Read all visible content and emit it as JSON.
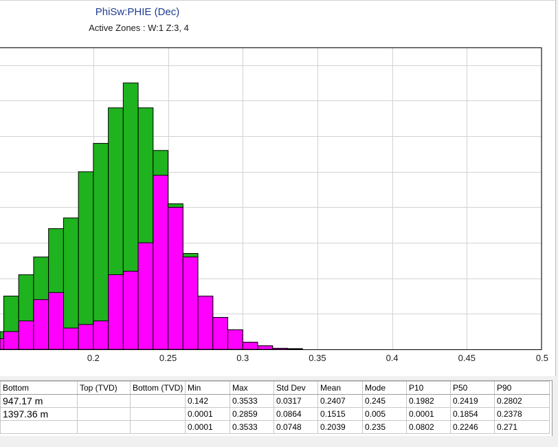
{
  "chart_data": {
    "type": "bar",
    "title": "PhiSw:PHIE (Dec)",
    "subtitle": "Active Zones :   W:1 Z:3, 4",
    "xlim": [
      0.1375,
      0.5
    ],
    "ylim": [
      0,
      8.5
    ],
    "xticks": [
      0.2,
      0.25,
      0.3,
      0.35,
      0.4,
      0.45,
      0.5
    ],
    "tick_labels": [
      "0.2",
      "0.25",
      "0.3",
      "0.35",
      "0.4",
      "0.45",
      "0.5"
    ],
    "bin_width": 0.01,
    "bin_starts": [
      0.13,
      0.14,
      0.15,
      0.16,
      0.17,
      0.18,
      0.19,
      0.2,
      0.21,
      0.22,
      0.23,
      0.24,
      0.25,
      0.26,
      0.27,
      0.28,
      0.29,
      0.3,
      0.31,
      0.32,
      0.33,
      0.34,
      0.35
    ],
    "series": [
      {
        "color": "#1fb31f",
        "values": [
          0.5,
          1.5,
          2.1,
          2.6,
          3.4,
          3.7,
          5.0,
          5.8,
          6.8,
          7.5,
          6.8,
          5.6,
          4.1,
          2.7,
          1.5,
          0.9,
          0.55,
          0.2,
          0.1,
          0.03,
          0.02,
          0.0,
          0.0
        ]
      },
      {
        "color": "#ff00ff",
        "values": [
          0.3,
          0.5,
          0.8,
          1.4,
          1.6,
          0.6,
          0.7,
          0.8,
          2.1,
          2.2,
          3.0,
          4.9,
          4.0,
          2.6,
          1.5,
          0.9,
          0.55,
          0.2,
          0.1,
          0.03,
          0.02,
          0.0,
          0.0
        ]
      }
    ],
    "grid": true,
    "legend": "none"
  },
  "stats_table": {
    "columns": [
      "Bottom",
      "Top (TVD)",
      "Bottom (TVD)",
      "Min",
      "Max",
      "Std Dev",
      "Mean",
      "Mode",
      "P10",
      "P50",
      "P90"
    ],
    "rows": [
      [
        "947.17 m",
        "",
        "",
        "0.142",
        "0.3533",
        "0.0317",
        "0.2407",
        "0.245",
        "0.1982",
        "0.2419",
        "0.2802"
      ],
      [
        "1397.36 m",
        "",
        "",
        "0.0001",
        "0.2859",
        "0.0864",
        "0.1515",
        "0.005",
        "0.0001",
        "0.1854",
        "0.2378"
      ],
      [
        "",
        "",
        "",
        "0.0001",
        "0.3533",
        "0.0748",
        "0.2039",
        "0.235",
        "0.0802",
        "0.2246",
        "0.271"
      ]
    ]
  }
}
